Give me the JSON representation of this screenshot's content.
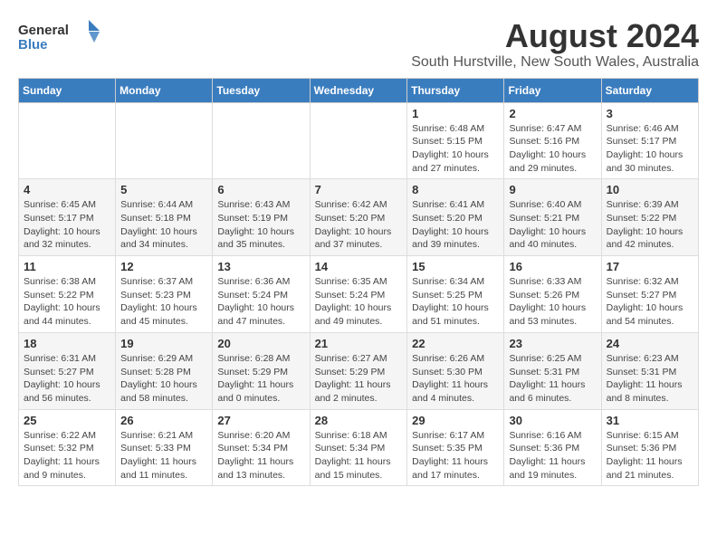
{
  "header": {
    "logo_general": "General",
    "logo_blue": "Blue",
    "title": "August 2024",
    "subtitle": "South Hurstville, New South Wales, Australia"
  },
  "weekdays": [
    "Sunday",
    "Monday",
    "Tuesday",
    "Wednesday",
    "Thursday",
    "Friday",
    "Saturday"
  ],
  "weeks": [
    [
      {
        "day": "",
        "info": ""
      },
      {
        "day": "",
        "info": ""
      },
      {
        "day": "",
        "info": ""
      },
      {
        "day": "",
        "info": ""
      },
      {
        "day": "1",
        "info": "Sunrise: 6:48 AM\nSunset: 5:15 PM\nDaylight: 10 hours\nand 27 minutes."
      },
      {
        "day": "2",
        "info": "Sunrise: 6:47 AM\nSunset: 5:16 PM\nDaylight: 10 hours\nand 29 minutes."
      },
      {
        "day": "3",
        "info": "Sunrise: 6:46 AM\nSunset: 5:17 PM\nDaylight: 10 hours\nand 30 minutes."
      }
    ],
    [
      {
        "day": "4",
        "info": "Sunrise: 6:45 AM\nSunset: 5:17 PM\nDaylight: 10 hours\nand 32 minutes."
      },
      {
        "day": "5",
        "info": "Sunrise: 6:44 AM\nSunset: 5:18 PM\nDaylight: 10 hours\nand 34 minutes."
      },
      {
        "day": "6",
        "info": "Sunrise: 6:43 AM\nSunset: 5:19 PM\nDaylight: 10 hours\nand 35 minutes."
      },
      {
        "day": "7",
        "info": "Sunrise: 6:42 AM\nSunset: 5:20 PM\nDaylight: 10 hours\nand 37 minutes."
      },
      {
        "day": "8",
        "info": "Sunrise: 6:41 AM\nSunset: 5:20 PM\nDaylight: 10 hours\nand 39 minutes."
      },
      {
        "day": "9",
        "info": "Sunrise: 6:40 AM\nSunset: 5:21 PM\nDaylight: 10 hours\nand 40 minutes."
      },
      {
        "day": "10",
        "info": "Sunrise: 6:39 AM\nSunset: 5:22 PM\nDaylight: 10 hours\nand 42 minutes."
      }
    ],
    [
      {
        "day": "11",
        "info": "Sunrise: 6:38 AM\nSunset: 5:22 PM\nDaylight: 10 hours\nand 44 minutes."
      },
      {
        "day": "12",
        "info": "Sunrise: 6:37 AM\nSunset: 5:23 PM\nDaylight: 10 hours\nand 45 minutes."
      },
      {
        "day": "13",
        "info": "Sunrise: 6:36 AM\nSunset: 5:24 PM\nDaylight: 10 hours\nand 47 minutes."
      },
      {
        "day": "14",
        "info": "Sunrise: 6:35 AM\nSunset: 5:24 PM\nDaylight: 10 hours\nand 49 minutes."
      },
      {
        "day": "15",
        "info": "Sunrise: 6:34 AM\nSunset: 5:25 PM\nDaylight: 10 hours\nand 51 minutes."
      },
      {
        "day": "16",
        "info": "Sunrise: 6:33 AM\nSunset: 5:26 PM\nDaylight: 10 hours\nand 53 minutes."
      },
      {
        "day": "17",
        "info": "Sunrise: 6:32 AM\nSunset: 5:27 PM\nDaylight: 10 hours\nand 54 minutes."
      }
    ],
    [
      {
        "day": "18",
        "info": "Sunrise: 6:31 AM\nSunset: 5:27 PM\nDaylight: 10 hours\nand 56 minutes."
      },
      {
        "day": "19",
        "info": "Sunrise: 6:29 AM\nSunset: 5:28 PM\nDaylight: 10 hours\nand 58 minutes."
      },
      {
        "day": "20",
        "info": "Sunrise: 6:28 AM\nSunset: 5:29 PM\nDaylight: 11 hours\nand 0 minutes."
      },
      {
        "day": "21",
        "info": "Sunrise: 6:27 AM\nSunset: 5:29 PM\nDaylight: 11 hours\nand 2 minutes."
      },
      {
        "day": "22",
        "info": "Sunrise: 6:26 AM\nSunset: 5:30 PM\nDaylight: 11 hours\nand 4 minutes."
      },
      {
        "day": "23",
        "info": "Sunrise: 6:25 AM\nSunset: 5:31 PM\nDaylight: 11 hours\nand 6 minutes."
      },
      {
        "day": "24",
        "info": "Sunrise: 6:23 AM\nSunset: 5:31 PM\nDaylight: 11 hours\nand 8 minutes."
      }
    ],
    [
      {
        "day": "25",
        "info": "Sunrise: 6:22 AM\nSunset: 5:32 PM\nDaylight: 11 hours\nand 9 minutes."
      },
      {
        "day": "26",
        "info": "Sunrise: 6:21 AM\nSunset: 5:33 PM\nDaylight: 11 hours\nand 11 minutes."
      },
      {
        "day": "27",
        "info": "Sunrise: 6:20 AM\nSunset: 5:34 PM\nDaylight: 11 hours\nand 13 minutes."
      },
      {
        "day": "28",
        "info": "Sunrise: 6:18 AM\nSunset: 5:34 PM\nDaylight: 11 hours\nand 15 minutes."
      },
      {
        "day": "29",
        "info": "Sunrise: 6:17 AM\nSunset: 5:35 PM\nDaylight: 11 hours\nand 17 minutes."
      },
      {
        "day": "30",
        "info": "Sunrise: 6:16 AM\nSunset: 5:36 PM\nDaylight: 11 hours\nand 19 minutes."
      },
      {
        "day": "31",
        "info": "Sunrise: 6:15 AM\nSunset: 5:36 PM\nDaylight: 11 hours\nand 21 minutes."
      }
    ]
  ]
}
